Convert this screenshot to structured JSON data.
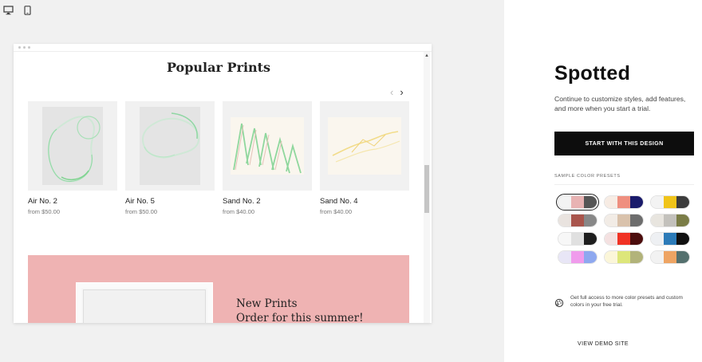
{
  "site": {
    "title": "Popular Prints",
    "products": [
      {
        "name": "Air No. 2",
        "price": "from $50.00",
        "art": "air2"
      },
      {
        "name": "Air No. 5",
        "price": "from $50.00",
        "art": "air5"
      },
      {
        "name": "Sand No. 2",
        "price": "from $40.00",
        "art": "sand2"
      },
      {
        "name": "Sand No. 4",
        "price": "from $40.00",
        "art": "sand4"
      }
    ],
    "banner": {
      "line1": "New Prints",
      "line2": "Order for this summer!",
      "color": "#efb3b3"
    }
  },
  "panel": {
    "brand": "Spotted",
    "description": "Continue to customize styles, add features, and more when you start a trial.",
    "cta": "START WITH THIS DESIGN",
    "presets_label": "SAMPLE COLOR PRESETS",
    "presets": [
      [
        "#f3f3f3",
        "#e8b3b3",
        "#555555"
      ],
      [
        "#f7ece4",
        "#ef8f7f",
        "#1a1b6b"
      ],
      [
        "#f3f3f3",
        "#f0c419",
        "#3c3c3c"
      ],
      [
        "#e9e3df",
        "#a9554c",
        "#888888"
      ],
      [
        "#f2ece6",
        "#d9c2ac",
        "#6d6d6d"
      ],
      [
        "#e8e5df",
        "#c3c1bc",
        "#7b7d47"
      ],
      [
        "#f7f7f7",
        "#e0e0e0",
        "#1e1e1e"
      ],
      [
        "#f4e1e1",
        "#f03224",
        "#4c0d0d"
      ],
      [
        "#eef0f3",
        "#2c7bb8",
        "#111111"
      ],
      [
        "#e8e6f6",
        "#f09bec",
        "#8ea8ef"
      ],
      [
        "#fbf6d9",
        "#dde67a",
        "#b2b37a"
      ],
      [
        "#f2f2f2",
        "#eea463",
        "#54706e"
      ]
    ],
    "selected_preset": 0,
    "upsell": "Get full access to more color presets and custom colors in your free trial.",
    "demo_link": "VIEW DEMO SITE"
  },
  "icons": {
    "desktop": "desktop-icon",
    "mobile": "mobile-icon",
    "palette": "palette-icon"
  }
}
